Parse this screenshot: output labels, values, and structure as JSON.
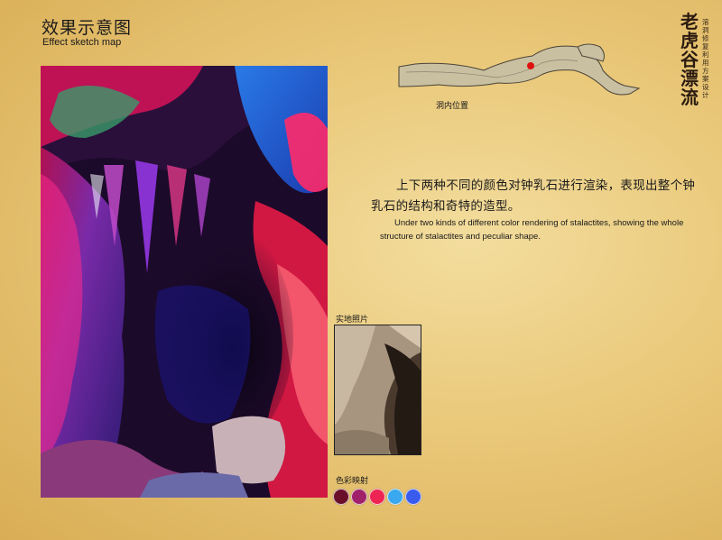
{
  "header": {
    "title_cn": "效果示意图",
    "title_en": "Effect sketch map"
  },
  "logo": {
    "title": "老虎谷漂流",
    "subtitle": "溶洞修复利用方案设计"
  },
  "cave_map": {
    "label": "洞内位置",
    "marker_color": "#e01010"
  },
  "description": {
    "cn": "上下两种不同的颜色对钟乳石进行渲染，表现出整个钟乳石的结构和奇特的造型。",
    "en": "Under two kinds of different color rendering of stalactites, showing the whole structure of stalactites and peculiar shape."
  },
  "real_photo": {
    "label": "实地照片"
  },
  "palette": {
    "label": "色彩映射",
    "colors": [
      "#6a0f2a",
      "#a0206a",
      "#ee2452",
      "#3aa8ee",
      "#3a5cee"
    ]
  }
}
